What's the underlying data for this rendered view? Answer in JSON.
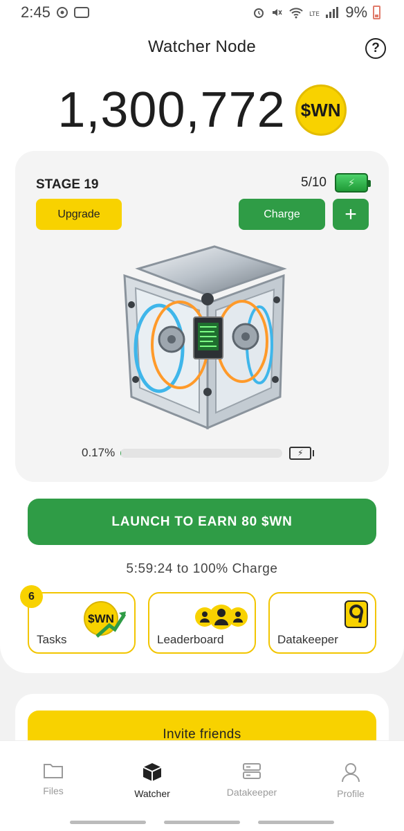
{
  "status_bar": {
    "time": "2:45",
    "battery": "9%"
  },
  "header": {
    "title": "Watcher Node",
    "help_icon": "question-circle-icon"
  },
  "balance": {
    "value": "1,300,772",
    "coin_label": "$WN"
  },
  "node": {
    "stage": "STAGE 19",
    "charges": "5/10",
    "upgrade_label": "Upgrade",
    "charge_label": "Charge",
    "plus_label": "+",
    "progress_text": "0.17%",
    "progress_fraction": 0.0017
  },
  "launch": {
    "label": "LAUNCH TO EARN 80 $WN"
  },
  "timer": {
    "text": "5:59:24 to 100% Charge"
  },
  "tiles": {
    "tasks": {
      "label": "Tasks",
      "badge": "6",
      "art_text": "$WN"
    },
    "leaderboard": {
      "label": "Leaderboard"
    },
    "datakeeper": {
      "label": "Datakeeper"
    }
  },
  "invite": {
    "label": "Invite friends"
  },
  "nav": {
    "files": "Files",
    "watcher": "Watcher",
    "datakeeper": "Datakeeper",
    "profile": "Profile"
  },
  "colors": {
    "accent_green": "#2f9c46",
    "accent_yellow": "#f8d200",
    "tile_border": "#f2c500"
  }
}
